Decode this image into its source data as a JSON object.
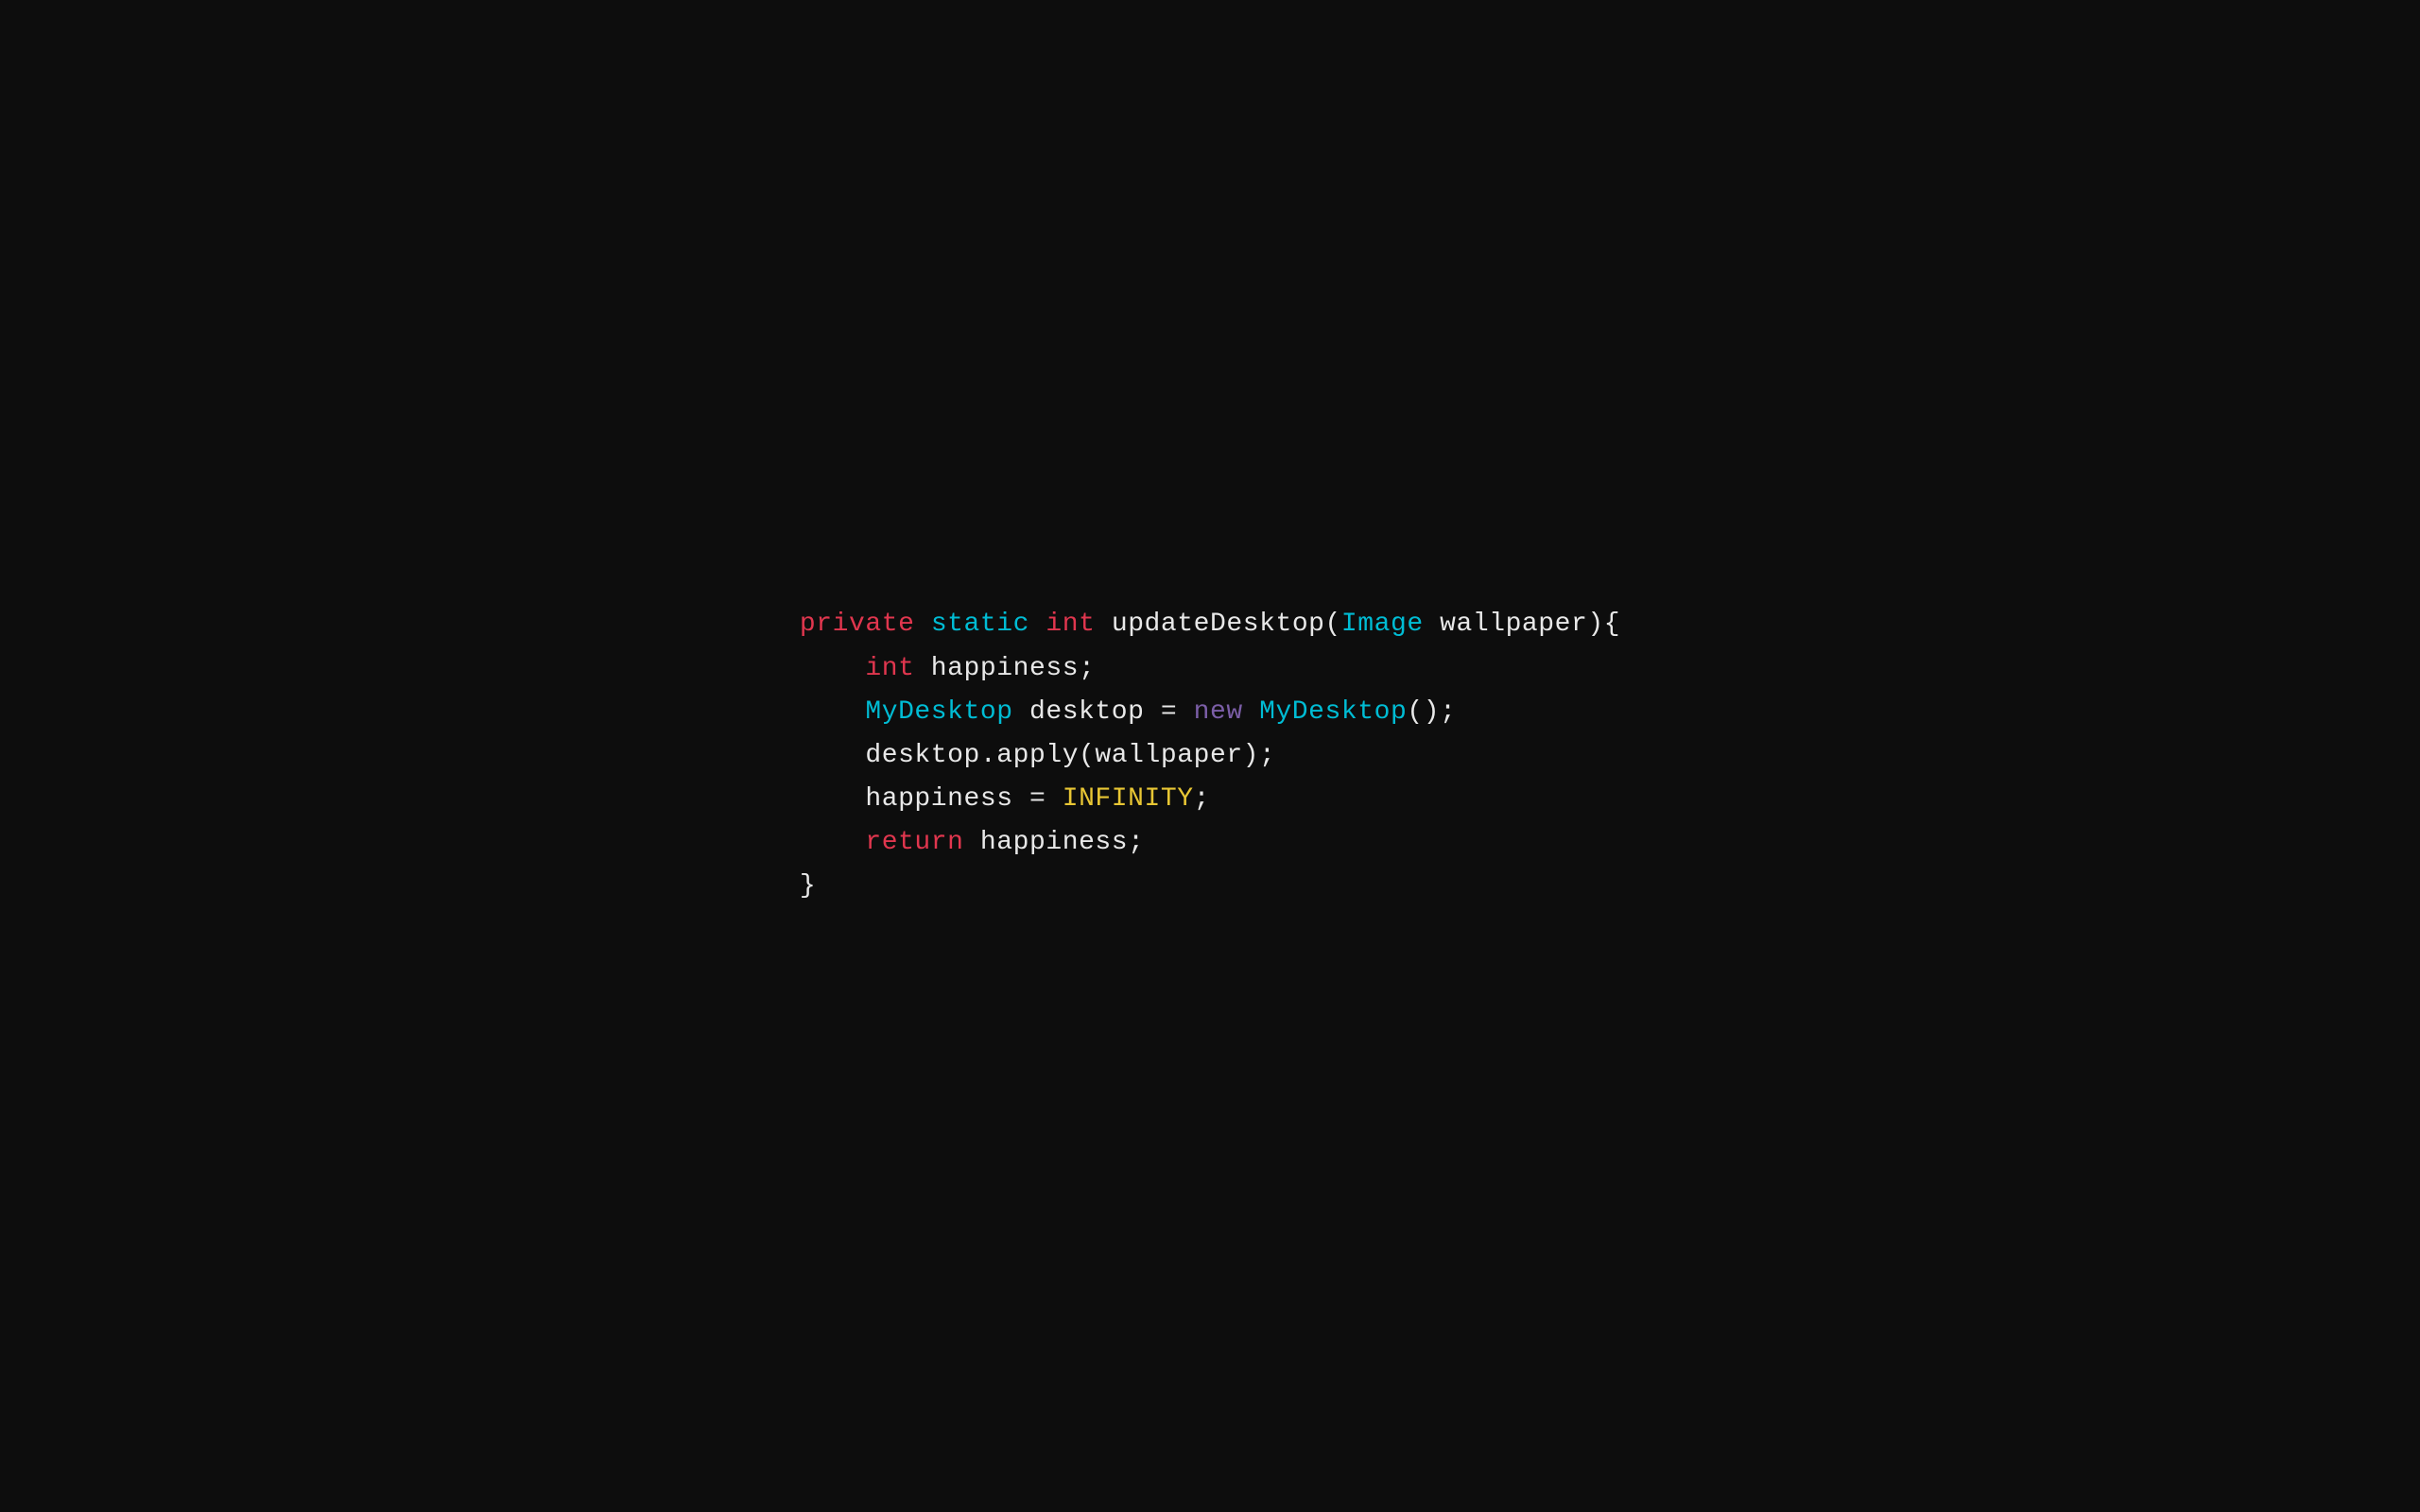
{
  "code": {
    "lines": [
      {
        "id": "line1",
        "parts": [
          {
            "id": "l1p1",
            "text": "private",
            "cls": "kw-private"
          },
          {
            "id": "l1p2",
            "text": " ",
            "cls": "plain"
          },
          {
            "id": "l1p3",
            "text": "static",
            "cls": "kw-static"
          },
          {
            "id": "l1p4",
            "text": " ",
            "cls": "plain"
          },
          {
            "id": "l1p5",
            "text": "int",
            "cls": "kw-int"
          },
          {
            "id": "l1p6",
            "text": " updateDesktop(",
            "cls": "plain"
          },
          {
            "id": "l1p7",
            "text": "Image",
            "cls": "kw-image"
          },
          {
            "id": "l1p8",
            "text": " wallpaper){",
            "cls": "plain"
          }
        ],
        "indent": 0
      },
      {
        "id": "line2",
        "parts": [
          {
            "id": "l2p1",
            "text": "int",
            "cls": "kw-int2"
          },
          {
            "id": "l2p2",
            "text": " happiness;",
            "cls": "plain"
          }
        ],
        "indent": 1
      },
      {
        "id": "line3",
        "parts": [
          {
            "id": "l3p1",
            "text": "MyDesktop",
            "cls": "kw-mydesktop"
          },
          {
            "id": "l3p2",
            "text": " desktop = ",
            "cls": "plain"
          },
          {
            "id": "l3p3",
            "text": "new",
            "cls": "kw-new"
          },
          {
            "id": "l3p4",
            "text": " ",
            "cls": "plain"
          },
          {
            "id": "l3p5",
            "text": "MyDesktop",
            "cls": "kw-mydesktop"
          },
          {
            "id": "l3p6",
            "text": "();",
            "cls": "plain"
          }
        ],
        "indent": 1
      },
      {
        "id": "line4",
        "parts": [
          {
            "id": "l4p1",
            "text": "desktop.apply(wallpaper);",
            "cls": "plain"
          }
        ],
        "indent": 1
      },
      {
        "id": "line5",
        "parts": [
          {
            "id": "l5p1",
            "text": "happiness = ",
            "cls": "plain"
          },
          {
            "id": "l5p2",
            "text": "INFINITY",
            "cls": "kw-infinity"
          },
          {
            "id": "l5p3",
            "text": ";",
            "cls": "plain"
          }
        ],
        "indent": 1
      },
      {
        "id": "line6",
        "parts": [
          {
            "id": "l6p1",
            "text": "return",
            "cls": "kw-return"
          },
          {
            "id": "l6p2",
            "text": " happiness;",
            "cls": "plain"
          }
        ],
        "indent": 1
      },
      {
        "id": "line7",
        "parts": [
          {
            "id": "l7p1",
            "text": "}",
            "cls": "brace"
          }
        ],
        "indent": 0
      }
    ],
    "indent_unit": "    "
  }
}
